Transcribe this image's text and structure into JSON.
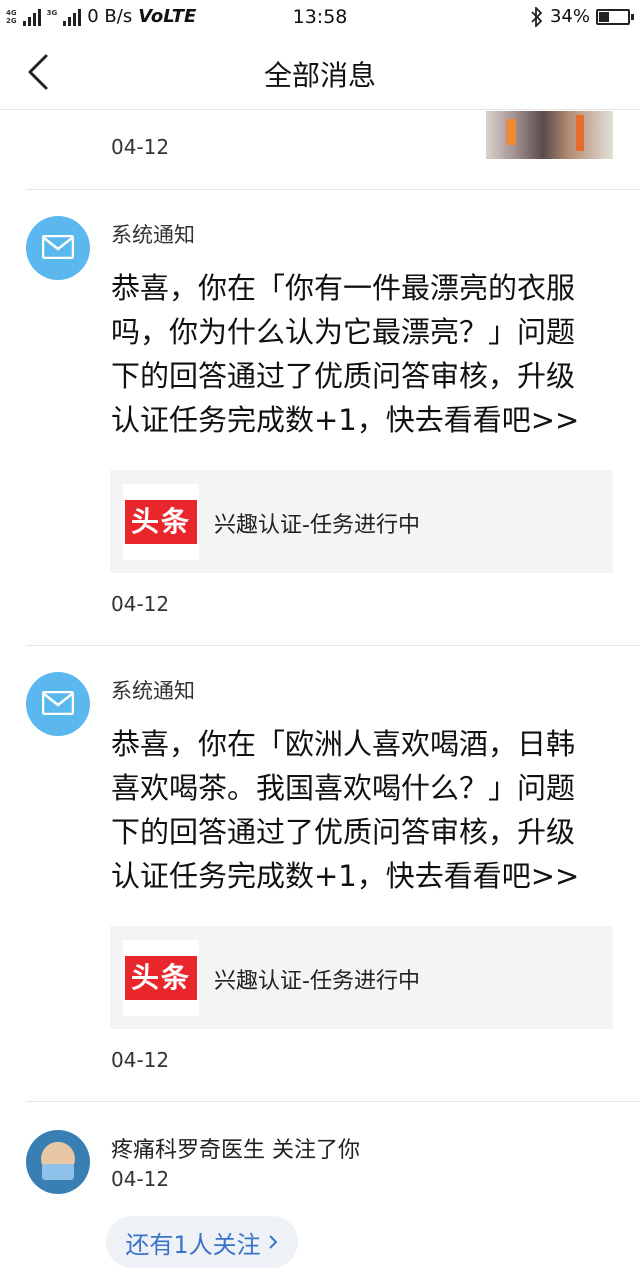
{
  "status_bar": {
    "net_top": "4G",
    "net_bottom": "2G",
    "net_3g": "3G",
    "speed": "0 B/s",
    "volte": "VoLTE",
    "time": "13:58",
    "battery_text": "34%",
    "battery_level": 0.34
  },
  "header": {
    "title": "全部消息"
  },
  "partial_item": {
    "date": "04-12"
  },
  "notices": [
    {
      "sender": "系统通知",
      "lines": [
        "恭喜，你在「你有一件最漂亮的衣服",
        "吗，你为什么认为它最漂亮？」问题",
        "下的回答通过了优质问答审核，升级",
        "认证任务完成数+1，快去看看吧>>"
      ],
      "card_logo": "头条",
      "card_label": "兴趣认证-任务进行中",
      "date": "04-12"
    },
    {
      "sender": "系统通知",
      "lines": [
        "恭喜，你在「欧洲人喜欢喝酒，日韩",
        "喜欢喝茶。我国喜欢喝什么？」问题",
        "下的回答通过了优质问答审核，升级",
        "认证任务完成数+1，快去看看吧>>"
      ],
      "card_logo": "头条",
      "card_label": "兴趣认证-任务进行中",
      "date": "04-12"
    }
  ],
  "follow": {
    "text": "疼痛科罗奇医生 关注了你",
    "date": "04-12",
    "more_label": "还有1人关注",
    "more_icon": "chevron-right-icon"
  }
}
